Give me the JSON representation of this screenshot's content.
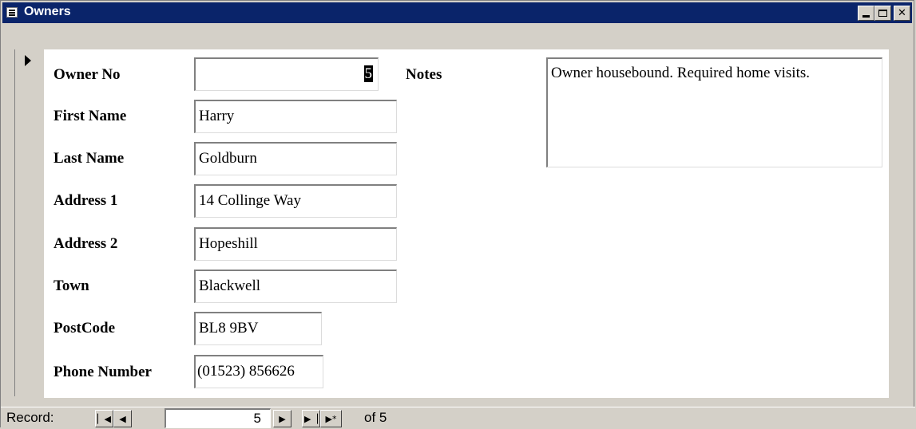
{
  "window": {
    "title": "Owners",
    "controls": {
      "minimize_icon": "minimize-icon",
      "maximize_icon": "maximize-icon",
      "close_icon": "close-icon"
    }
  },
  "form": {
    "fields": [
      {
        "label": "Owner No",
        "value": "5"
      },
      {
        "label": "First Name",
        "value": "Harry"
      },
      {
        "label": "Last Name",
        "value": "Goldburn"
      },
      {
        "label": "Address 1",
        "value": "14 Collinge Way"
      },
      {
        "label": "Address 2",
        "value": "Hopeshill"
      },
      {
        "label": "Town",
        "value": "Blackwell"
      },
      {
        "label": "PostCode",
        "value": "BL8 9BV"
      },
      {
        "label": "Phone Number",
        "value": "(01523) 856626"
      }
    ],
    "notes": {
      "label": "Notes",
      "value": "Owner housebound.  Required home visits."
    }
  },
  "navigation": {
    "label": "Record:",
    "current": "5",
    "of_text": "of 5",
    "buttons": {
      "first": "▏◀",
      "prev": "◀",
      "next": "▶",
      "last": "▶▕",
      "new": "▶*"
    }
  }
}
